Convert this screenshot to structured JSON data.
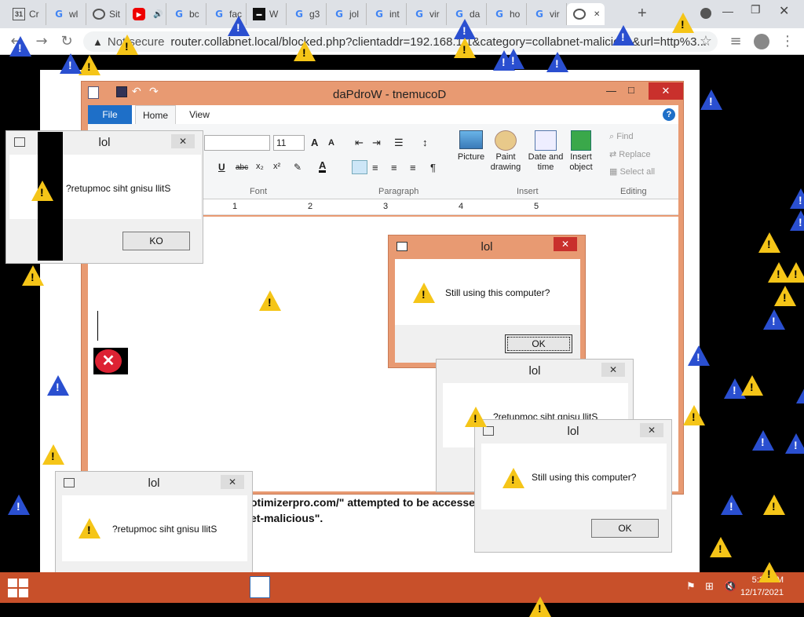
{
  "browser": {
    "tabs": [
      {
        "label": "Cr",
        "icon": "calendar-icon"
      },
      {
        "label": "wl",
        "icon": "google-icon"
      },
      {
        "label": "Sit",
        "icon": "globe-icon"
      },
      {
        "label": "",
        "icon": "youtube-icon"
      },
      {
        "label": "bc",
        "icon": "google-icon"
      },
      {
        "label": "fac",
        "icon": "google-icon"
      },
      {
        "label": "W",
        "icon": "site-dark-icon"
      },
      {
        "label": "g3",
        "icon": "google-icon"
      },
      {
        "label": "jol",
        "icon": "google-icon"
      },
      {
        "label": "int",
        "icon": "google-icon"
      },
      {
        "label": "vir",
        "icon": "google-icon"
      },
      {
        "label": "da",
        "icon": "google-icon"
      },
      {
        "label": "ho",
        "icon": "google-icon"
      },
      {
        "label": "vir",
        "icon": "google-icon"
      },
      {
        "label": "",
        "icon": "globe-icon",
        "active": true
      }
    ],
    "new_tab": "+",
    "security_label": "Not secure",
    "url": "router.collabnet.local/blocked.php?clientaddr=192.168.1.1&category=collabnet-malicious&url=http%3..."
  },
  "page": {
    "line1": "otimizerpro.com/\" attempted to be accessed by 1",
    "line2": "et-malicious\"."
  },
  "wordpad": {
    "title": "daPdroW - tnemucoD",
    "tabs": {
      "file": "File",
      "home": "Home",
      "view": "View"
    },
    "font_size": "11",
    "groups": {
      "font": "Font",
      "paragraph": "Paragraph",
      "insert": "Insert",
      "editing": "Editing"
    },
    "insert": {
      "picture": "Picture",
      "paint": "Paint drawing",
      "datetime": "Date and time",
      "object": "Insert object"
    },
    "editing": {
      "find": "Find",
      "replace": "Replace",
      "select_all": "Select all"
    },
    "ruler": [
      "1",
      "2",
      "3",
      "4",
      "5"
    ]
  },
  "dialogs": {
    "title": "lol",
    "still_using": "Still using this computer?",
    "reversed": "?retupmoc siht gnisu llitS",
    "ok": "OK",
    "ko": "KO"
  },
  "taskbar": {
    "time": "5:32 AM",
    "date": "12/17/2021"
  },
  "colors": {
    "accent_orange": "#e89a72",
    "taskbar": "#c8502a",
    "warning_yellow": "#f5c518",
    "warning_blue": "#2a4fd0"
  }
}
